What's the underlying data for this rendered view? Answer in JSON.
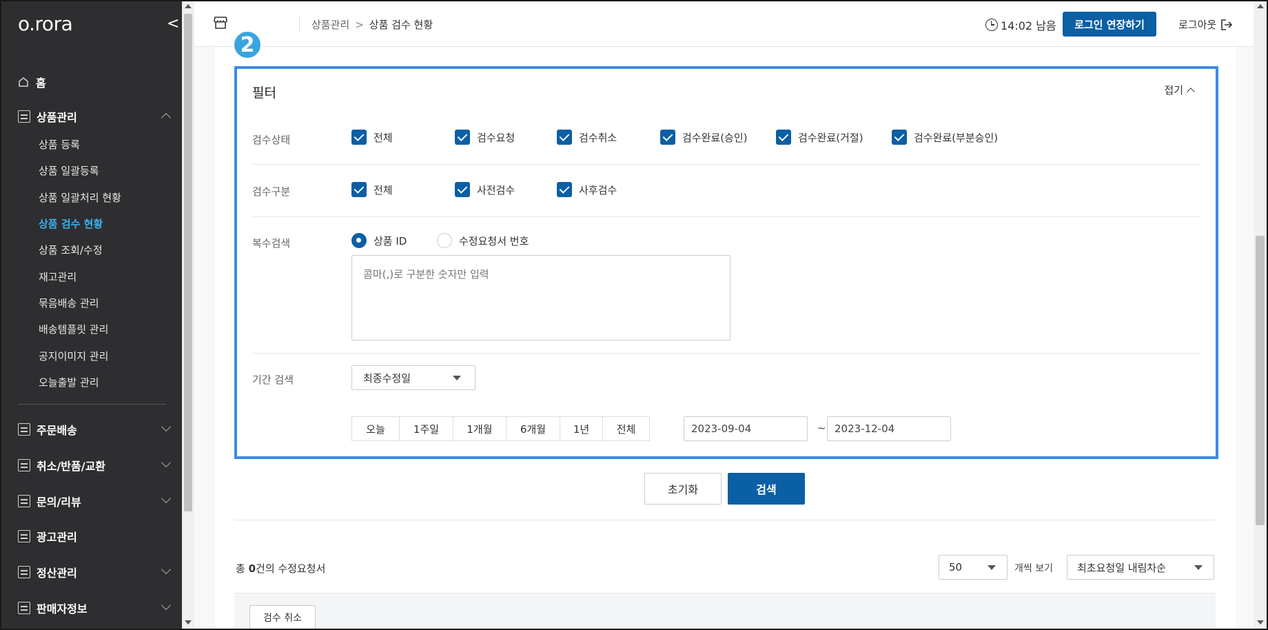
{
  "sidebar": {
    "logo": "o.rora",
    "collapse_glyph": "<",
    "home_label": "홈",
    "product_mgmt_label": "상품관리",
    "sub_items": [
      {
        "label": "상품 등록",
        "active": false
      },
      {
        "label": "상품 일괄등록",
        "active": false
      },
      {
        "label": "상품 일괄처리 현황",
        "active": false
      },
      {
        "label": "상품 검수 현황",
        "active": true
      },
      {
        "label": "상품 조회/수정",
        "active": false
      },
      {
        "label": "재고관리",
        "active": false
      },
      {
        "label": "묶음배송 관리",
        "active": false
      },
      {
        "label": "배송템플릿 관리",
        "active": false
      },
      {
        "label": "공지이미지 관리",
        "active": false
      },
      {
        "label": "오늘출발 관리",
        "active": false
      }
    ],
    "sections": [
      {
        "label": "주문배송"
      },
      {
        "label": "취소/반품/교환"
      },
      {
        "label": "문의/리뷰"
      },
      {
        "label": "광고관리"
      },
      {
        "label": "정산관리"
      },
      {
        "label": "판매자정보"
      }
    ]
  },
  "header": {
    "breadcrumb_parent": "상품관리",
    "breadcrumb_sep": ">",
    "breadcrumb_current": "상품 검수 현황",
    "timer": "14:02 남음",
    "extend_label": "로그인 연장하기",
    "logout_label": "로그아웃"
  },
  "step_badge": "2",
  "filter": {
    "title": "필터",
    "collapse_label": "접기",
    "status": {
      "label": "검수상태",
      "options": [
        "전체",
        "검수요청",
        "검수취소",
        "검수완료(승인)",
        "검수완료(거절)",
        "검수완료(부분승인)"
      ]
    },
    "type": {
      "label": "검수구분",
      "options": [
        "전체",
        "사전검수",
        "사후검수"
      ]
    },
    "multi_search": {
      "label": "복수검색",
      "radio_product_id": "상품 ID",
      "radio_request_no": "수정요청서 번호",
      "selected": "상품 ID",
      "placeholder": "콤마(,)로 구분한 숫자만 입력"
    },
    "period": {
      "label": "기간 검색",
      "date_type": "최종수정일",
      "quick": [
        "오늘",
        "1주일",
        "1개월",
        "6개월",
        "1년",
        "전체"
      ],
      "start": "2023-09-04",
      "tilde": "~",
      "end": "2023-12-04"
    }
  },
  "actions": {
    "reset_label": "초기화",
    "search_label": "검색"
  },
  "results": {
    "total_prefix": "총 ",
    "total_count": "0",
    "total_suffix": "건의 수정요청서",
    "per_page": "50",
    "per_page_label": "개씩 보기",
    "sort": "최초요청일 내림차순",
    "cancel_label": "검수 취소"
  },
  "colors": {
    "primary": "#0b5fa5",
    "sidebar_bg": "#2e2e30",
    "active_nav": "#3ab0f0",
    "highlight_border": "#3d8be0"
  }
}
